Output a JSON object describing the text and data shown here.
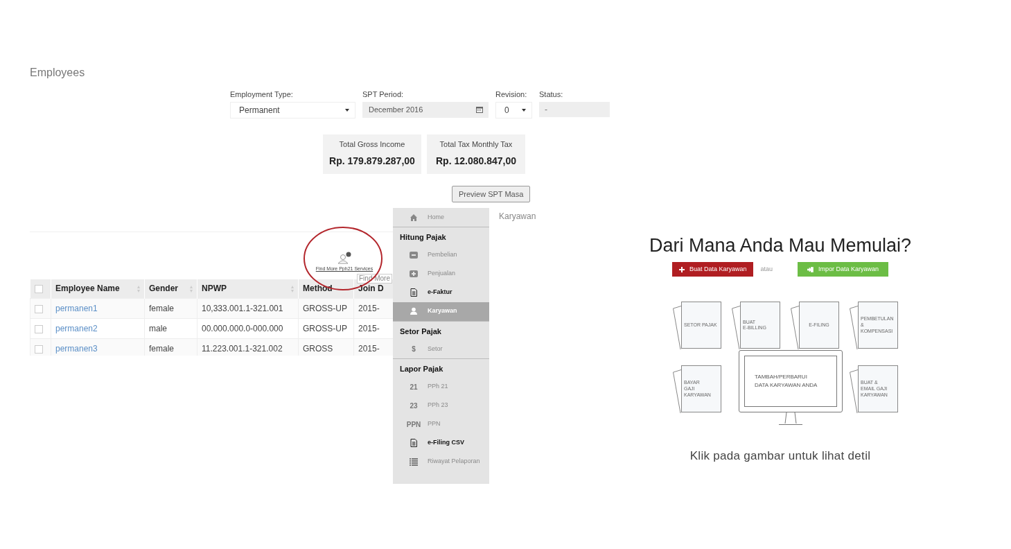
{
  "employees_page": {
    "title": "Employees",
    "filters": [
      {
        "label": "Employment Type:",
        "value": "Permanent",
        "kind": "select"
      },
      {
        "label": "SPT Period:",
        "value": "December 2016",
        "kind": "date"
      },
      {
        "label": "Revision:",
        "value": "0",
        "kind": "select"
      },
      {
        "label": "Status:",
        "value": "-",
        "kind": "readonly"
      }
    ],
    "totals": [
      {
        "label": "Total Gross Income",
        "value": "Rp. 179.879.287,00"
      },
      {
        "label": "Total Tax Monthly Tax",
        "value": "Rp. 12.080.847,00"
      }
    ],
    "preview_button": "Preview SPT Masa",
    "services_link": "Find More Pph21 Services",
    "tooltip": "Find More",
    "table": {
      "select_all": false,
      "columns": [
        {
          "label": "Employee Name",
          "sortable": true
        },
        {
          "label": "Gender",
          "sortable": true
        },
        {
          "label": "NPWP",
          "sortable": true
        },
        {
          "label": "Method",
          "sortable": false
        },
        {
          "label": "Join D"
        }
      ],
      "rows": [
        {
          "selected": false,
          "cells": [
            "permanen1",
            "female",
            "10,333.001.1-321.001",
            "GROSS-UP",
            "2015-"
          ]
        },
        {
          "selected": false,
          "cells": [
            "permanen2",
            "male",
            "00.000.000.0-000.000",
            "GROSS-UP",
            "2015-"
          ]
        },
        {
          "selected": false,
          "cells": [
            "permanen3",
            "female",
            "11.223.001.1-321.002",
            "GROSS",
            "2015-"
          ]
        }
      ]
    }
  },
  "menu": {
    "page_title": "Karyawan",
    "items": [
      {
        "kind": "house",
        "label": "Home",
        "disabled": true,
        "selected": false
      },
      {
        "kind": "section",
        "label": "Hitung Pajak"
      },
      {
        "kind": "minus",
        "label": "Pembelian",
        "disabled": true,
        "selected": false
      },
      {
        "kind": "plus",
        "label": "Penjualan",
        "disabled": true,
        "selected": false
      },
      {
        "kind": "doc",
        "label": "e-Faktur",
        "disabled": false,
        "selected": false
      },
      {
        "kind": "user",
        "label": "Karyawan",
        "disabled": false,
        "selected": true
      },
      {
        "kind": "section",
        "label": "Setor Pajak"
      },
      {
        "kind": "symbol",
        "icon_text": "$",
        "label": "Setor",
        "disabled": true,
        "selected": false
      },
      {
        "kind": "section",
        "label": "Lapor Pajak"
      },
      {
        "kind": "symbol",
        "icon_text": "21",
        "label": "PPh 21",
        "disabled": true,
        "selected": false
      },
      {
        "kind": "symbol",
        "icon_text": "23",
        "label": "PPh 23",
        "disabled": true,
        "selected": false
      },
      {
        "kind": "symbol",
        "icon_text": "PPN",
        "label": "PPN",
        "disabled": true,
        "selected": false
      },
      {
        "kind": "doc",
        "label": "e-Filing CSV",
        "disabled": false,
        "selected": false
      },
      {
        "kind": "list",
        "label": "Riwayat Pelaporan",
        "disabled": true,
        "selected": false
      }
    ]
  },
  "start_panel": {
    "title": "Dari Mana Anda Mau Memulai?",
    "create_button": "Buat Data Karyawan",
    "separator": "atau",
    "import_button": "Impor Data Karyawan",
    "tiles": [
      {
        "label": "SETOR PAJAK",
        "kind": "doc"
      },
      {
        "label": "BUAT\nE-BILLING",
        "kind": "doc"
      },
      {
        "label": "E-FILING",
        "kind": "doc"
      },
      {
        "label": "PEMBETULAN &\nKOMPENSASI",
        "kind": "doc"
      },
      {
        "label": "BAYAR\nGAJI\nKARYAWAN",
        "kind": "doc"
      },
      {
        "label": "TAMBAH/PERBARUI\nDATA KARYAWAN ANDA",
        "kind": "monitor"
      },
      {
        "label": "BUAT &\nEMAIL GAJI\nKARYAWAN",
        "kind": "doc"
      }
    ],
    "hint": "Klik pada gambar untuk lihat detil"
  }
}
